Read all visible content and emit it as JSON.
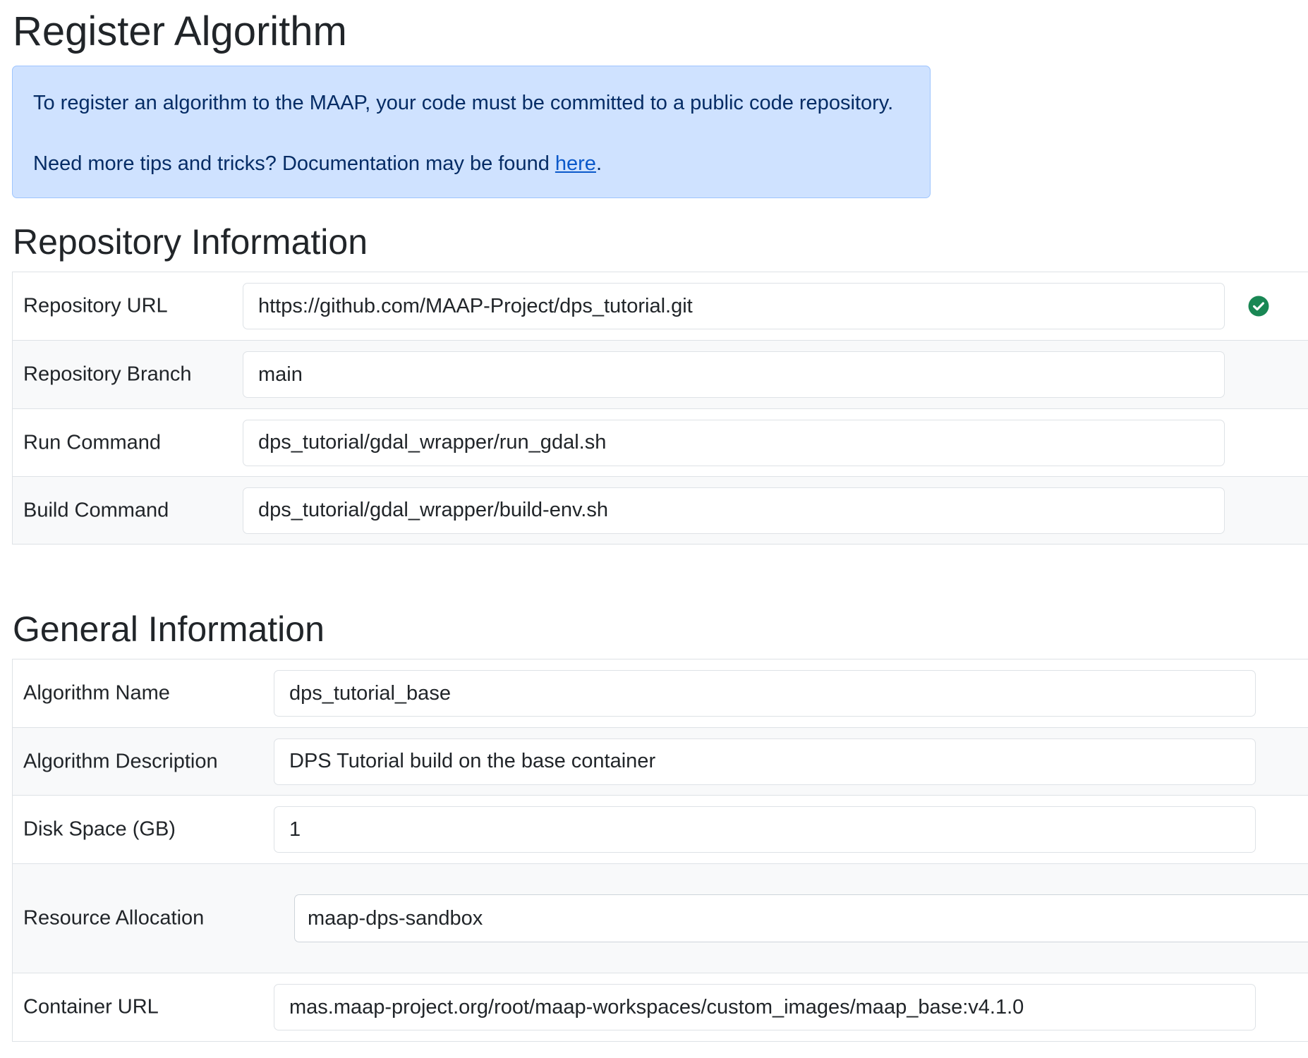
{
  "page": {
    "title": "Register Algorithm"
  },
  "alert": {
    "line1": "To register an algorithm to the MAAP, your code must be committed to a public code repository.",
    "line2_prefix": "Need more tips and tricks? Documentation may be found ",
    "link_text": "here",
    "line2_suffix": "."
  },
  "repository": {
    "title": "Repository Information",
    "url_label": "Repository URL",
    "url_value": "https://github.com/MAAP-Project/dps_tutorial.git",
    "url_status_icon": "check-circle-icon",
    "branch_label": "Repository Branch",
    "branch_value": "main",
    "run_label": "Run Command",
    "run_value": "dps_tutorial/gdal_wrapper/run_gdal.sh",
    "build_label": "Build Command",
    "build_value": "dps_tutorial/gdal_wrapper/build-env.sh"
  },
  "general": {
    "title": "General Information",
    "name_label": "Algorithm Name",
    "name_value": "dps_tutorial_base",
    "desc_label": "Algorithm Description",
    "desc_value": "DPS Tutorial build on the base container",
    "disk_label": "Disk Space (GB)",
    "disk_value": "1",
    "resource_label": "Resource Allocation",
    "resource_value": "maap-dps-sandbox",
    "container_label": "Container URL",
    "container_value": "mas.maap-project.org/root/maap-workspaces/custom_images/maap_base:v4.1.0"
  },
  "colors": {
    "alert_bg": "#cfe2ff",
    "alert_text": "#052c65",
    "link": "#0a58ca",
    "valid": "#198754",
    "stripe": "#f8f9fa",
    "border": "#dee2e6"
  }
}
